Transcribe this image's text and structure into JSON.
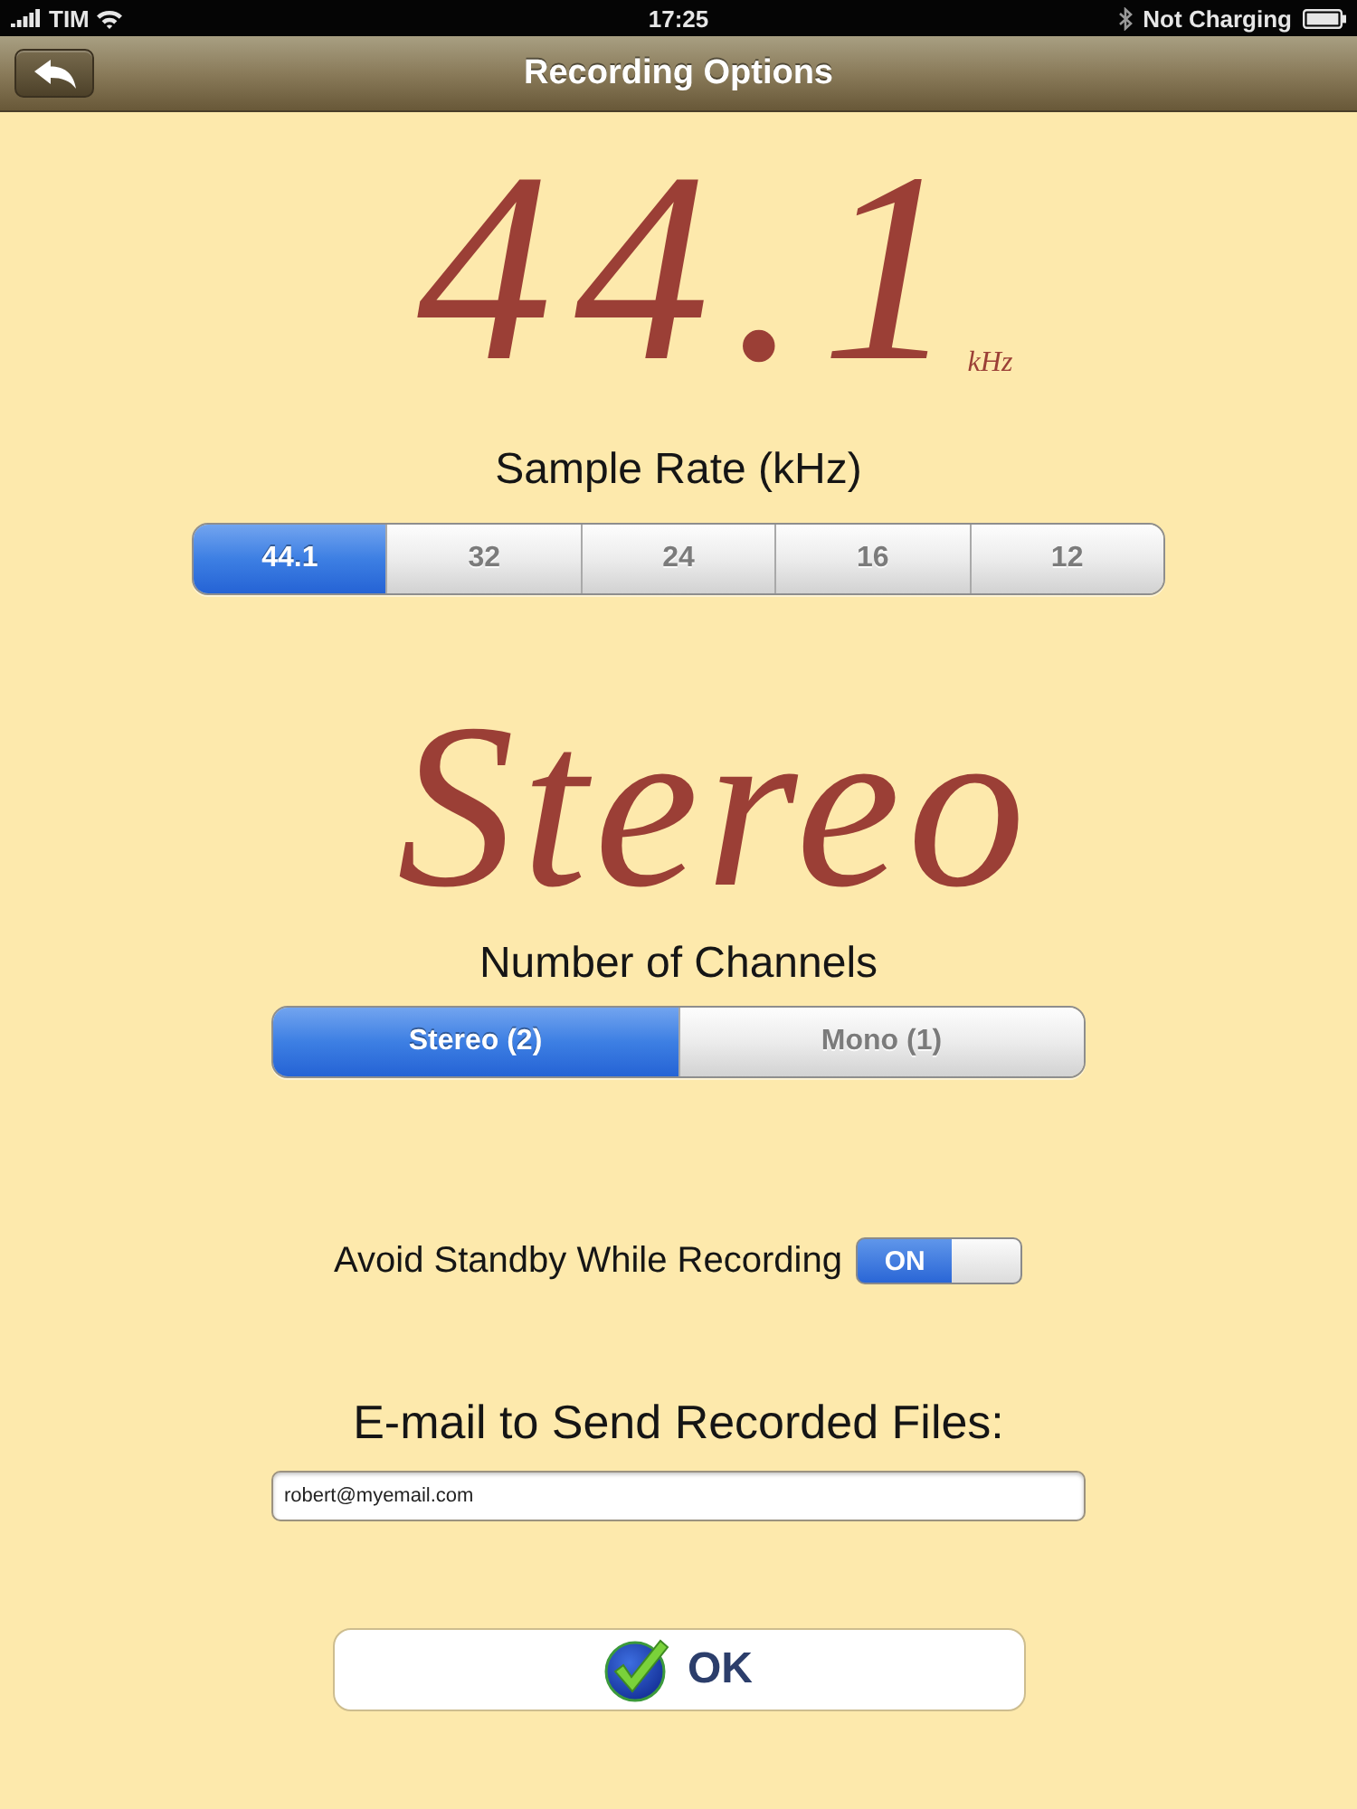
{
  "status_bar": {
    "carrier": "TIM",
    "time": "17:25",
    "charging": "Not Charging"
  },
  "nav_bar": {
    "title": "Recording Options"
  },
  "sample_rate": {
    "display": "44.1",
    "unit": "kHz",
    "label": "Sample Rate (kHz)",
    "options": [
      {
        "label": "44.1",
        "selected": true
      },
      {
        "label": "32",
        "selected": false
      },
      {
        "label": "24",
        "selected": false
      },
      {
        "label": "16",
        "selected": false
      },
      {
        "label": "12",
        "selected": false
      }
    ]
  },
  "channels": {
    "display": "Stereo",
    "label": "Number of Channels",
    "options": [
      {
        "label": "Stereo (2)",
        "selected": true
      },
      {
        "label": "Mono (1)",
        "selected": false
      }
    ]
  },
  "standby": {
    "label": "Avoid Standby While Recording",
    "on": true,
    "state_label": "ON"
  },
  "email": {
    "label": "E-mail to Send Recorded Files:",
    "value": "robert@myemail.com"
  },
  "ok_button": {
    "label": "OK"
  }
}
